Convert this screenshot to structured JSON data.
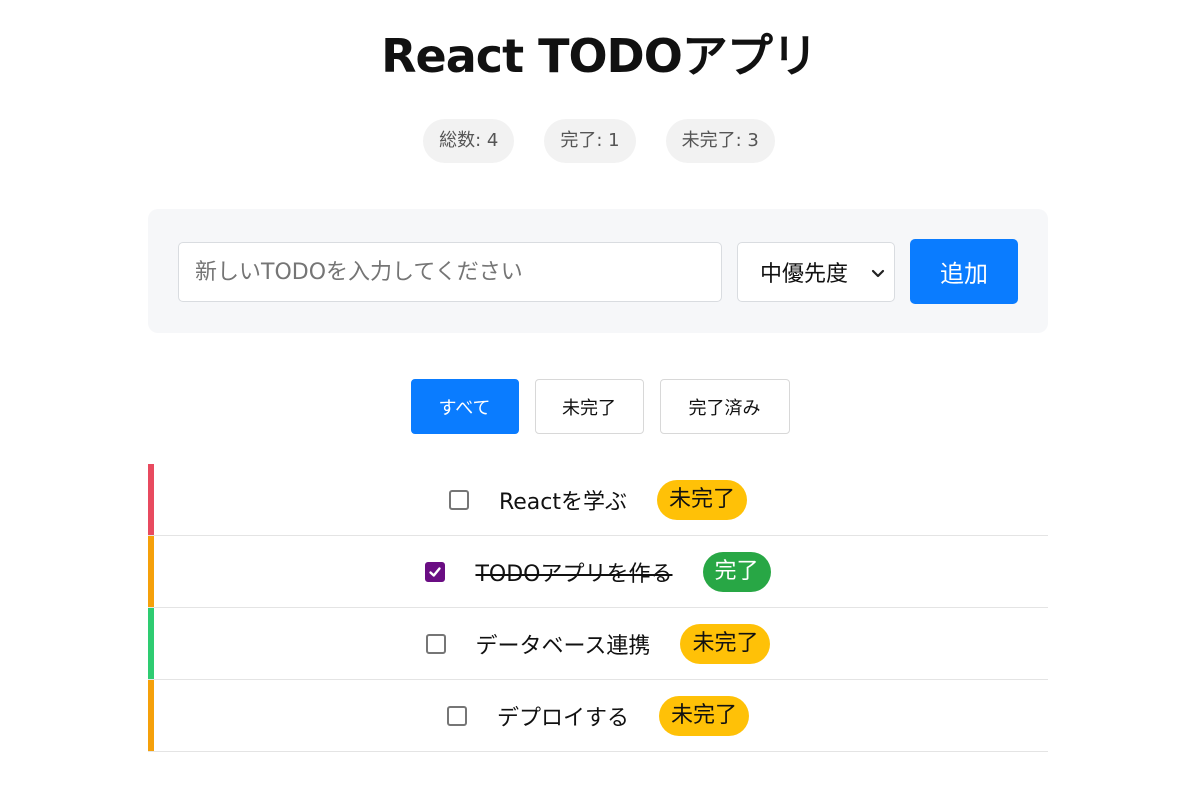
{
  "app": {
    "title": "React TODOアプリ"
  },
  "stats": [
    {
      "label": "総数: 4"
    },
    {
      "label": "完了: 1"
    },
    {
      "label": "未完了: 3"
    }
  ],
  "form": {
    "input_placeholder": "新しいTODOを入力してください",
    "input_value": "",
    "priority_selected": "中優先度",
    "add_label": "追加"
  },
  "filters": [
    {
      "label": "すべて",
      "active": true
    },
    {
      "label": "未完了",
      "active": false
    },
    {
      "label": "完了済み",
      "active": false
    }
  ],
  "todos": [
    {
      "text": "Reactを学ぶ",
      "done": false,
      "status": "未完了",
      "priority_color": "#e84a5f",
      "badge_color": "#ffc107"
    },
    {
      "text": "TODOアプリを作る",
      "done": true,
      "status": "完了",
      "priority_color": "#f5a00a",
      "badge_color": "#28a745"
    },
    {
      "text": "データベース連携",
      "done": false,
      "status": "未完了",
      "priority_color": "#2ecc71",
      "badge_color": "#ffc107"
    },
    {
      "text": "デプロイする",
      "done": false,
      "status": "未完了",
      "priority_color": "#f5a00a",
      "badge_color": "#ffc107"
    }
  ],
  "colors": {
    "accent": "#0a7cff",
    "checkbox_checked": "#6a0d83"
  },
  "icons": {
    "select_arrow": "chevron-down-icon",
    "check": "check-icon"
  }
}
